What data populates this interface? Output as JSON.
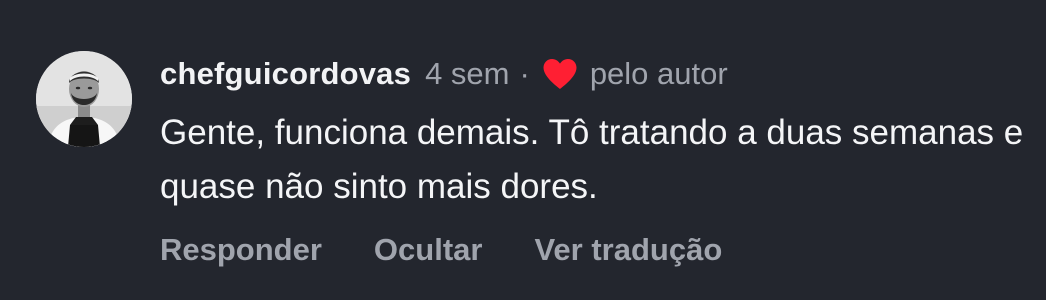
{
  "comment": {
    "author": "chefguicordovas",
    "time": "4 sem",
    "separator": "·",
    "liked_by_author_label": "pelo autor",
    "text": "Gente, funciona demais. Tô tratando a duas semanas e quase não sinto mais dores.",
    "actions": {
      "reply": "Responder",
      "hide": "Ocultar",
      "translate": "Ver tradução"
    }
  },
  "colors": {
    "background": "#23262e",
    "heart": "#ff1f33",
    "muted_text": "#a0a4ad",
    "primary_text": "#f2f3f5"
  },
  "icons": {
    "heart": "heart-icon",
    "avatar": "profile-photo"
  }
}
